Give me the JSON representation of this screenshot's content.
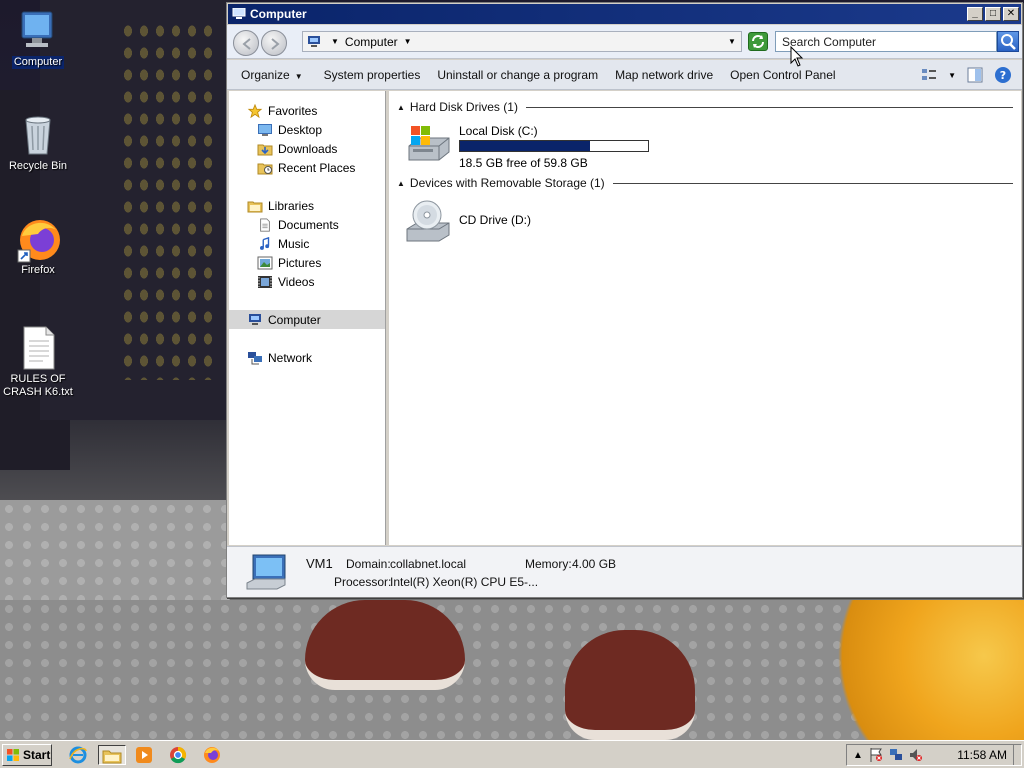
{
  "desktop": {
    "icons": [
      {
        "label": "Computer",
        "icon": "computer-icon"
      },
      {
        "label": "Recycle Bin",
        "icon": "recycle-bin-icon"
      },
      {
        "label": "Firefox",
        "icon": "firefox-icon"
      },
      {
        "label": "RULES OF CRASH K6.txt",
        "icon": "text-file-icon"
      }
    ]
  },
  "window": {
    "title": "Computer",
    "address": {
      "location": "Computer"
    },
    "search": {
      "placeholder": "Search Computer"
    },
    "toolbar": {
      "organize": "Organize",
      "system_properties": "System properties",
      "uninstall": "Uninstall or change a program",
      "map_drive": "Map network drive",
      "control_panel": "Open Control Panel"
    },
    "nav": {
      "favorites": "Favorites",
      "desktop": "Desktop",
      "downloads": "Downloads",
      "recent_places": "Recent Places",
      "libraries": "Libraries",
      "documents": "Documents",
      "music": "Music",
      "pictures": "Pictures",
      "videos": "Videos",
      "computer": "Computer",
      "network": "Network"
    },
    "groups": {
      "hdd": "Hard Disk Drives (1)",
      "removable": "Devices with Removable Storage (1)"
    },
    "drives": {
      "local_disk": {
        "name": "Local Disk (C:)",
        "free_text": "18.5 GB free of 59.8 GB",
        "used_fraction": 0.69
      },
      "cd_drive": {
        "name": "CD Drive (D:)"
      }
    },
    "details": {
      "name": "VM1",
      "domain_label": "Domain:",
      "domain_value": "collabnet.local",
      "memory_label": "Memory:",
      "memory_value": "4.00 GB",
      "processor_label": "Processor:",
      "processor_value": "Intel(R) Xeon(R) CPU E5-..."
    }
  },
  "taskbar": {
    "start_label": "Start",
    "clock": "11:58 AM"
  },
  "colors": {
    "titlebar": "#0a246a",
    "selection": "#0a246a",
    "disk_bar": "#0a246a"
  }
}
